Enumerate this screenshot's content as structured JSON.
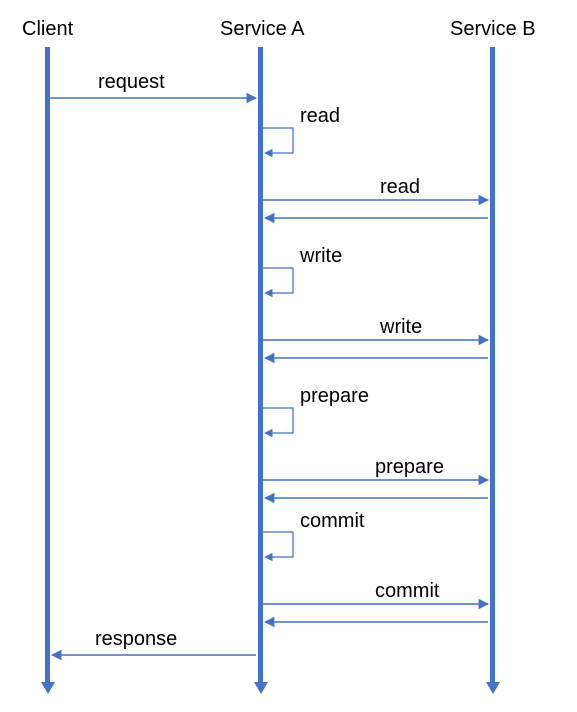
{
  "participants": {
    "client": "Client",
    "serviceA": "Service A",
    "serviceB": "Service B"
  },
  "messages": {
    "request": "request",
    "read_self": "read",
    "read_b": "read",
    "write_self": "write",
    "write_b": "write",
    "prepare_self": "prepare",
    "prepare_b": "prepare",
    "commit_self": "commit",
    "commit_b": "commit",
    "response": "response"
  },
  "colors": {
    "line": "#4472c4"
  },
  "chart_data": {
    "type": "sequence-diagram",
    "participants": [
      "Client",
      "Service A",
      "Service B"
    ],
    "interactions": [
      {
        "from": "Client",
        "to": "Service A",
        "label": "request"
      },
      {
        "from": "Service A",
        "to": "Service A",
        "label": "read"
      },
      {
        "from": "Service A",
        "to": "Service B",
        "label": "read",
        "return": true
      },
      {
        "from": "Service A",
        "to": "Service A",
        "label": "write"
      },
      {
        "from": "Service A",
        "to": "Service B",
        "label": "write",
        "return": true
      },
      {
        "from": "Service A",
        "to": "Service A",
        "label": "prepare"
      },
      {
        "from": "Service A",
        "to": "Service B",
        "label": "prepare",
        "return": true
      },
      {
        "from": "Service A",
        "to": "Service A",
        "label": "commit"
      },
      {
        "from": "Service A",
        "to": "Service B",
        "label": "commit",
        "return": true
      },
      {
        "from": "Service A",
        "to": "Client",
        "label": "response"
      }
    ]
  }
}
